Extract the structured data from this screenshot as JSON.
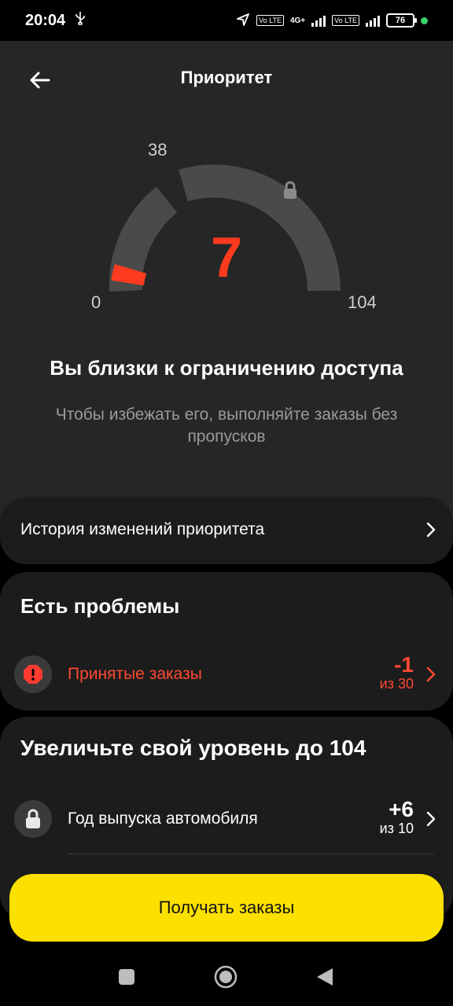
{
  "status_bar": {
    "time": "20:04",
    "battery": "76",
    "network": "4G+",
    "volte1": "Vo LTE",
    "volte2": "Vo LTE"
  },
  "header": {
    "title": "Приоритет"
  },
  "gauge": {
    "value": "7",
    "min_label": "0",
    "mid_label": "38",
    "max_label": "104",
    "level": 7,
    "max": 104,
    "value_color": "#ff3b1f"
  },
  "message": {
    "title": "Вы близки к ограничению доступа",
    "subtitle": "Чтобы избежать его, выполняйте заказы без пропусков"
  },
  "history": {
    "label": "История изменений приоритета"
  },
  "problems": {
    "title": "Есть проблемы",
    "items": [
      {
        "label": "Принятые заказы",
        "value": "-1",
        "of": "из 30",
        "icon": "alert-icon"
      }
    ]
  },
  "increase": {
    "title": "Увеличьте свой уровень до 104",
    "items": [
      {
        "label": "Год выпуска автомобиля",
        "value": "+6",
        "of": "из 10",
        "icon": "lock-icon"
      }
    ]
  },
  "cta": {
    "label": "Получать заказы",
    "color": "#fce000"
  },
  "nav": {
    "icons": [
      "square-icon",
      "circle-icon",
      "triangle-back-icon"
    ]
  }
}
